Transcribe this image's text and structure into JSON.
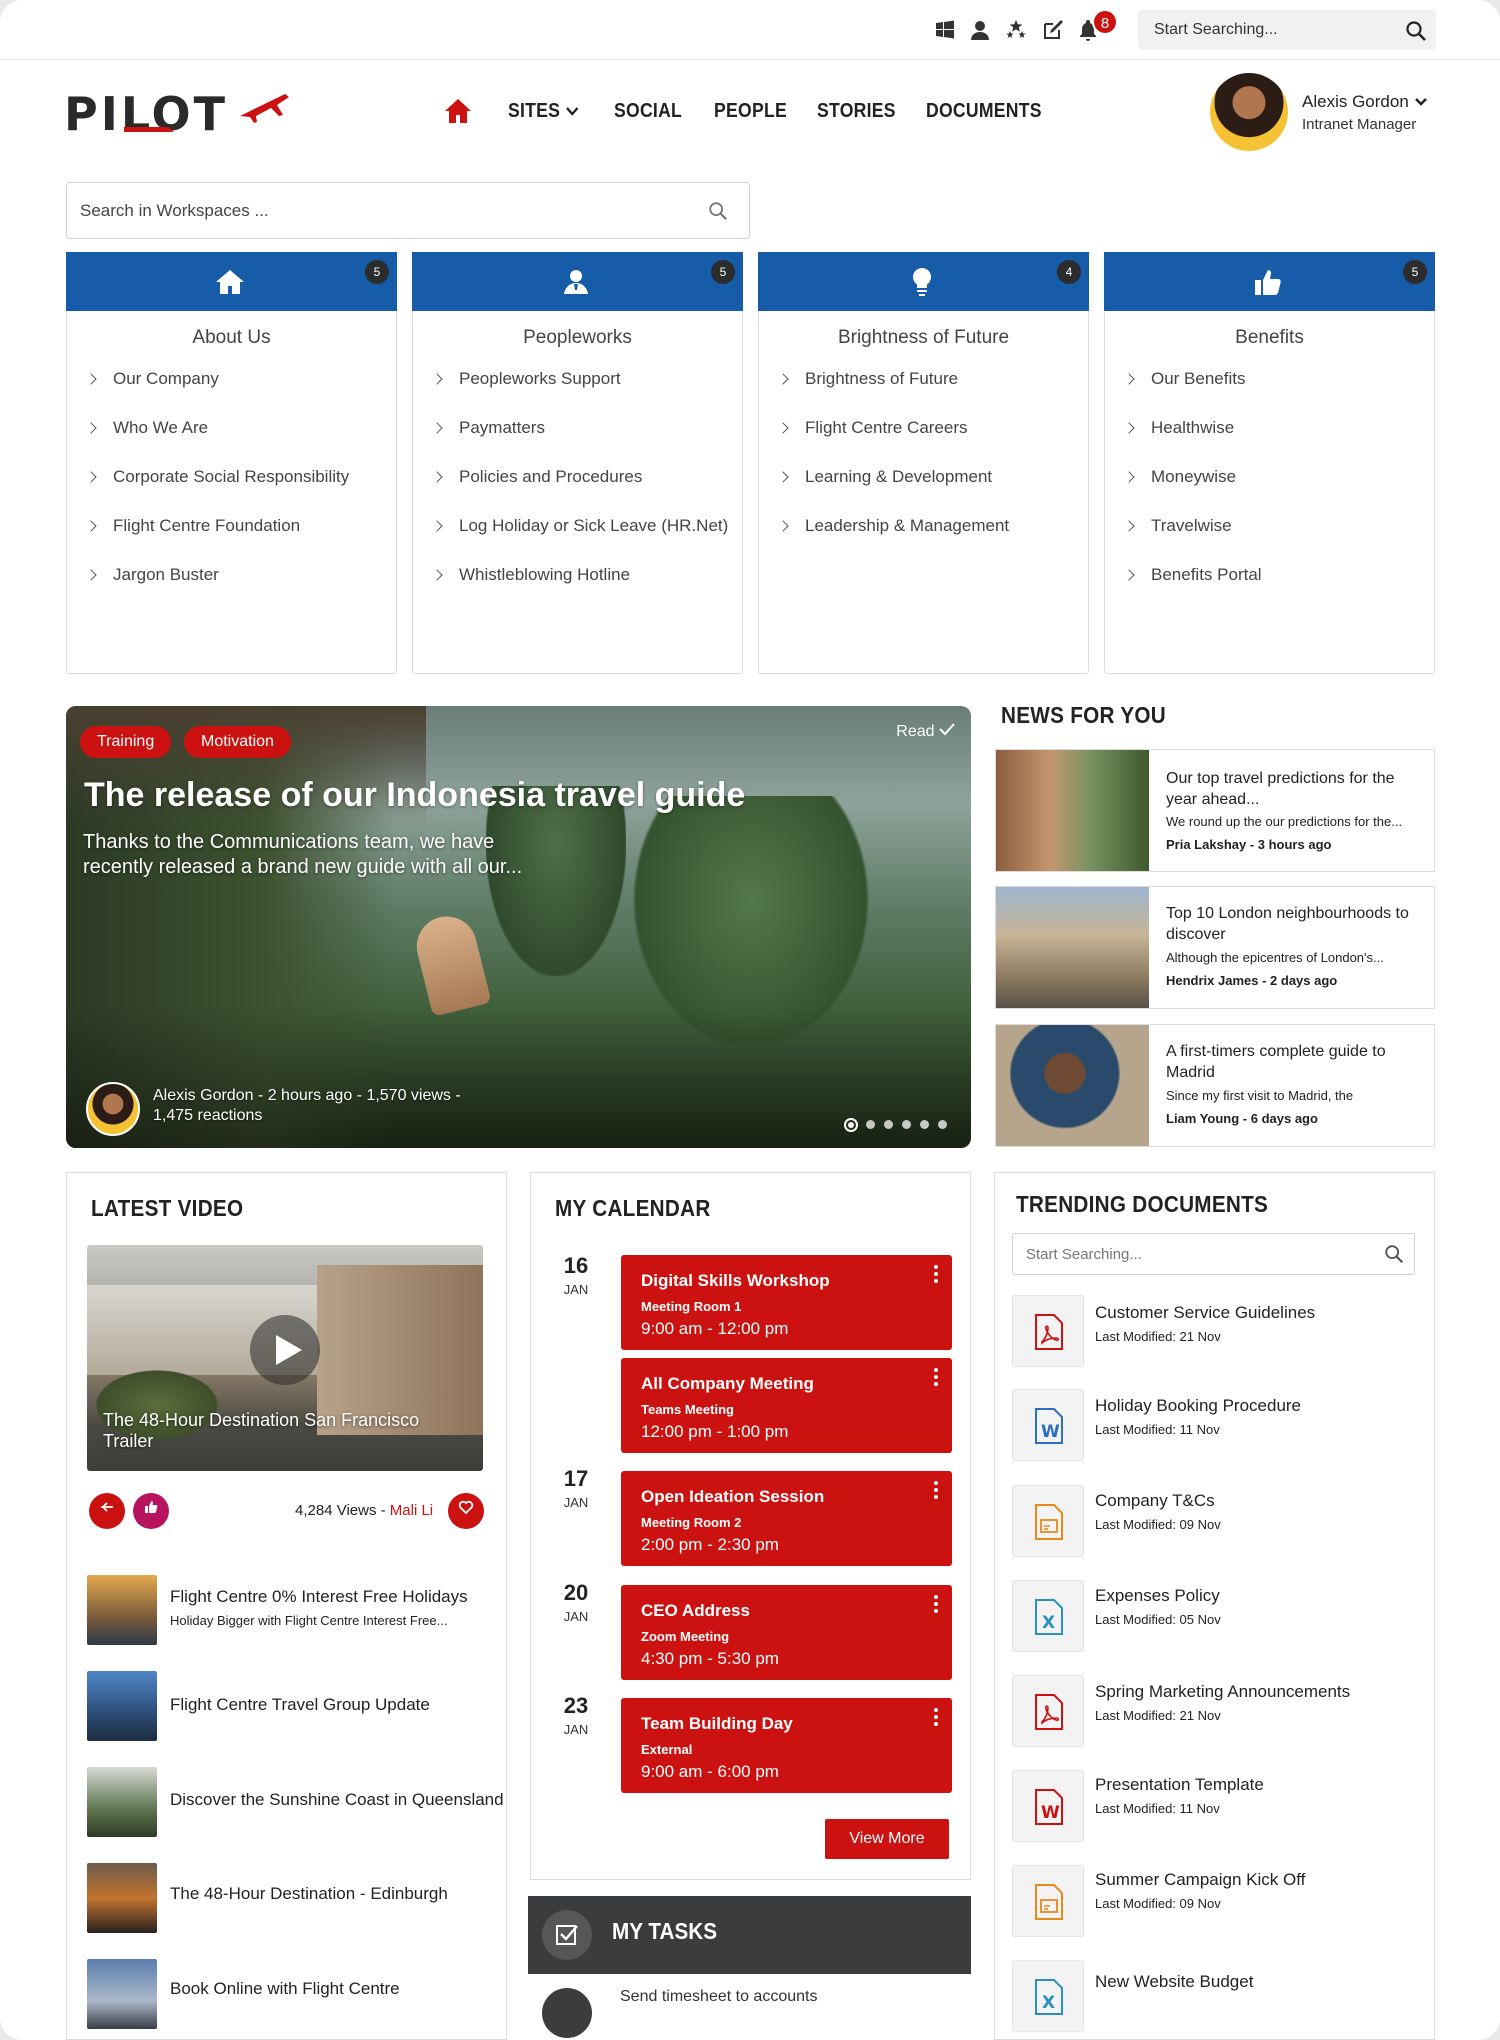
{
  "topbar": {
    "notification_count": "8",
    "search_placeholder": "Start Searching..."
  },
  "header": {
    "logo_text": "PILOT",
    "nav": [
      "SITES",
      "SOCIAL",
      "PEOPLE",
      "STORIES",
      "DOCUMENTS"
    ],
    "user": {
      "name": "Alexis Gordon",
      "role": "Intranet Manager"
    }
  },
  "workspace_search": {
    "placeholder": "Search in Workspaces ..."
  },
  "categories": [
    {
      "title": "About Us",
      "count": "5",
      "icon": "home-icon",
      "links": [
        "Our Company",
        "Who We Are",
        "Corporate Social Responsibility",
        "Flight Centre Foundation",
        "Jargon Buster"
      ]
    },
    {
      "title": "Peopleworks",
      "count": "5",
      "icon": "people-icon",
      "links": [
        "Peopleworks Support",
        "Paymatters",
        "Policies and Procedures",
        "Log Holiday or Sick Leave (HR.Net)",
        "Whistleblowing Hotline"
      ]
    },
    {
      "title": "Brightness of Future",
      "count": "4",
      "icon": "lightbulb-icon",
      "links": [
        "Brightness of Future",
        "Flight Centre Careers",
        "Learning & Development",
        "Leadership & Management"
      ]
    },
    {
      "title": "Benefits",
      "count": "5",
      "icon": "thumbs-up-icon",
      "links": [
        "Our Benefits",
        "Healthwise",
        "Moneywise",
        "Travelwise",
        "Benefits Portal"
      ]
    }
  ],
  "hero": {
    "tags": [
      "Training",
      "Motivation"
    ],
    "read_label": "Read",
    "title": "The release of our Indonesia travel guide",
    "subtitle": "Thanks to the Communications team, we have recently released a brand new guide with all our...",
    "meta": "Alexis Gordon - 2 hours ago - 1,570 views - 1,475 reactions",
    "slides": 6,
    "active_slide": 1
  },
  "news": {
    "heading": "NEWS FOR YOU",
    "items": [
      {
        "title": "Our top travel predictions for the year ahead...",
        "excerpt": "We round up the our predictions for the...",
        "byline": "Pria Lakshay - 3 hours ago"
      },
      {
        "title": "Top 10 London neighbourhoods to discover",
        "excerpt": "Although the epicentres of London's...",
        "byline": "Hendrix James - 2 days ago"
      },
      {
        "title": "A first-timers complete guide to Madrid",
        "excerpt": "Since my first visit to Madrid, the",
        "byline": "Liam Young - 6 days ago"
      }
    ]
  },
  "video": {
    "heading": "LATEST VIDEO",
    "caption": "The 48-Hour Destination San Francisco Trailer",
    "views": "4,284 Views - ",
    "author": "Mali Li",
    "list": [
      {
        "title": "Flight Centre 0% Interest Free Holidays",
        "sub": "Holiday Bigger with Flight Centre Interest Free..."
      },
      {
        "title": "Flight Centre Travel Group Update",
        "sub": ""
      },
      {
        "title": "Discover the Sunshine Coast in Queensland",
        "sub": ""
      },
      {
        "title": "The 48-Hour Destination - Edinburgh",
        "sub": ""
      },
      {
        "title": "Book Online with Flight Centre",
        "sub": ""
      }
    ]
  },
  "calendar": {
    "heading": "MY CALENDAR",
    "days": [
      {
        "day": "16",
        "month": "JAN"
      },
      {
        "day": "17",
        "month": "JAN"
      },
      {
        "day": "20",
        "month": "JAN"
      },
      {
        "day": "23",
        "month": "JAN"
      }
    ],
    "events": [
      {
        "title": "Digital Skills Workshop",
        "location": "Meeting Room 1",
        "time": "9:00 am - 12:00 pm"
      },
      {
        "title": "All Company Meeting",
        "location": "Teams Meeting",
        "time": "12:00 pm - 1:00 pm"
      },
      {
        "title": "Open Ideation Session",
        "location": "Meeting Room 2",
        "time": "2:00 pm - 2:30 pm"
      },
      {
        "title": "CEO Address",
        "location": "Zoom Meeting",
        "time": "4:30 pm - 5:30 pm"
      },
      {
        "title": "Team Building Day",
        "location": "External",
        "time": "9:00 am - 6:00 pm"
      }
    ],
    "view_more": "View More"
  },
  "tasks": {
    "heading": "MY TASKS",
    "first_item": "Send timesheet to accounts"
  },
  "documents": {
    "heading": "TRENDING DOCUMENTS",
    "search_placeholder": "Start Searching...",
    "items": [
      {
        "title": "Customer Service Guidelines",
        "modified": "Last Modified: 21 Nov",
        "type": "pdf"
      },
      {
        "title": "Holiday Booking Procedure",
        "modified": "Last Modified: 11 Nov",
        "type": "word-blue"
      },
      {
        "title": "Company T&Cs",
        "modified": "Last Modified: 09 Nov",
        "type": "slides"
      },
      {
        "title": "Expenses Policy",
        "modified": "Last Modified: 05 Nov",
        "type": "excel"
      },
      {
        "title": "Spring Marketing Announcements",
        "modified": "Last Modified: 21 Nov",
        "type": "pdf"
      },
      {
        "title": "Presentation Template",
        "modified": "Last Modified: 11 Nov",
        "type": "word-red"
      },
      {
        "title": "Summer Campaign Kick Off",
        "modified": "Last Modified: 09 Nov",
        "type": "slides"
      },
      {
        "title": "New Website Budget",
        "modified": "",
        "type": "excel"
      }
    ]
  },
  "colors": {
    "brand_red": "#cc1111",
    "card_blue": "#165ca8",
    "dark": "#222222"
  }
}
